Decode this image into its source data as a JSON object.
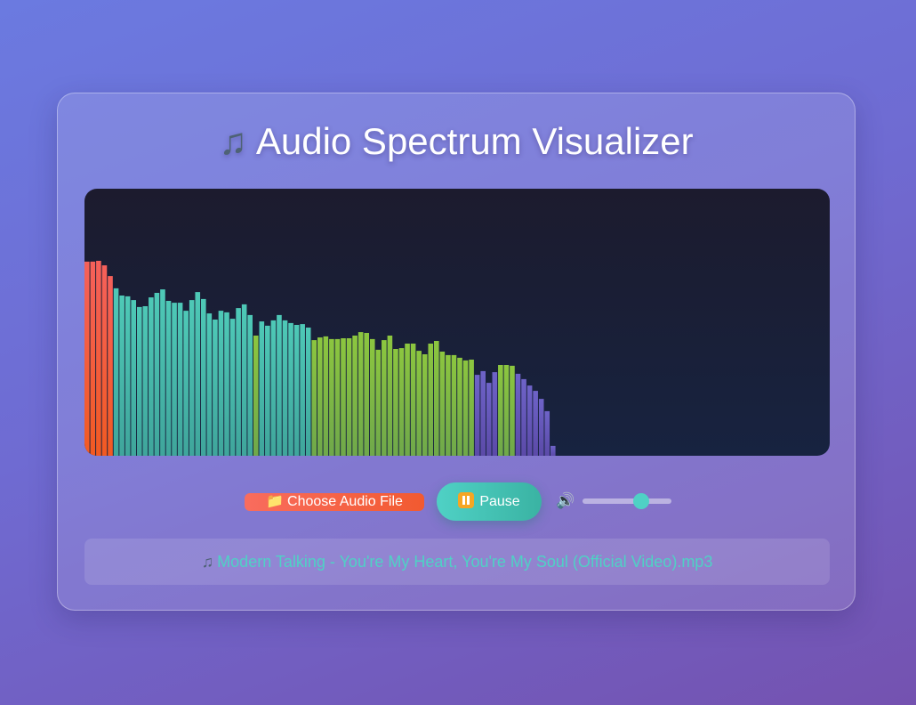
{
  "header": {
    "title": "Audio Spectrum Visualizer",
    "title_icon": "music-note-icon"
  },
  "visualizer": {
    "bar_levels": [
      0.727,
      0.727,
      0.73,
      0.713,
      0.673,
      0.627,
      0.6,
      0.597,
      0.583,
      0.557,
      0.56,
      0.593,
      0.61,
      0.623,
      0.58,
      0.573,
      0.573,
      0.543,
      0.583,
      0.613,
      0.587,
      0.533,
      0.51,
      0.543,
      0.537,
      0.513,
      0.553,
      0.567,
      0.527,
      0.45,
      0.503,
      0.487,
      0.507,
      0.527,
      0.507,
      0.497,
      0.49,
      0.493,
      0.48,
      0.433,
      0.443,
      0.447,
      0.437,
      0.437,
      0.44,
      0.44,
      0.45,
      0.463,
      0.46,
      0.437,
      0.397,
      0.433,
      0.45,
      0.4,
      0.403,
      0.42,
      0.42,
      0.393,
      0.38,
      0.42,
      0.43,
      0.39,
      0.377,
      0.377,
      0.367,
      0.357,
      0.36,
      0.303,
      0.317,
      0.273,
      0.313,
      0.34,
      0.34,
      0.337,
      0.307,
      0.287,
      0.263,
      0.243,
      0.213,
      0.167,
      0.037
    ],
    "bar_colors": {
      "red": "#f5605a",
      "teal": "#4ec9b7",
      "lime": "#8cc63f",
      "purple": "#6e63c8"
    }
  },
  "controls": {
    "file_button_icon": "folder-icon",
    "file_button_label": "Choose Audio File",
    "pause_button_label": "Pause",
    "volume_icon": "speaker-icon",
    "volume_level": 0.66
  },
  "now_playing": {
    "icon": "music-note-icon",
    "filename": "Modern Talking - You're My Heart, You're My Soul (Official Video).mp3"
  },
  "colors": {
    "accent": "#4fd1c5",
    "file_button": "#f5603f",
    "visualizer_bg": "#1c1b2e"
  }
}
